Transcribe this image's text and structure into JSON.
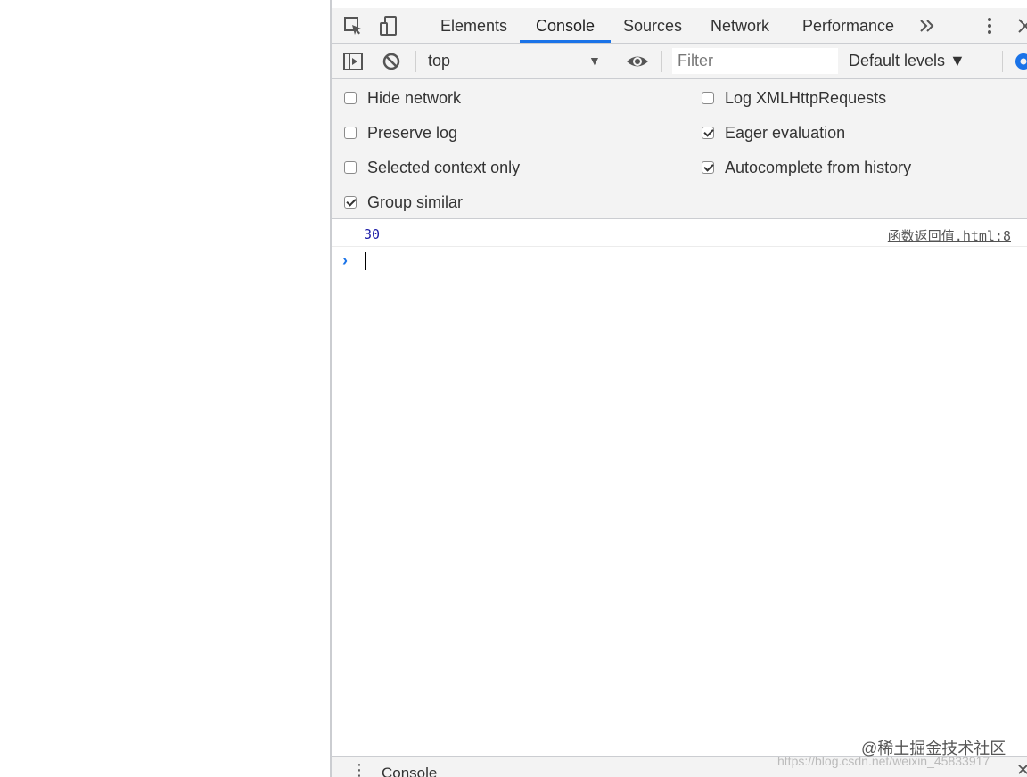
{
  "tabs": [
    "Elements",
    "Console",
    "Sources",
    "Network",
    "Performance"
  ],
  "active_tab": "Console",
  "toolbar": {
    "context": "top",
    "filter_placeholder": "Filter",
    "levels": "Default levels ▼"
  },
  "settings": {
    "hide_network": {
      "label": "Hide network",
      "checked": false
    },
    "preserve_log": {
      "label": "Preserve log",
      "checked": false
    },
    "selected_context_only": {
      "label": "Selected context only",
      "checked": false
    },
    "group_similar": {
      "label": "Group similar",
      "checked": true
    },
    "log_xhr": {
      "label": "Log XMLHttpRequests",
      "checked": false
    },
    "eager_evaluation": {
      "label": "Eager evaluation",
      "checked": true
    },
    "autocomplete_history": {
      "label": "Autocomplete from history",
      "checked": true
    }
  },
  "console": {
    "message_value": "30",
    "message_source": "函数返回值.html:8"
  },
  "drawer": {
    "tab": "Console"
  },
  "watermark": {
    "main": "@稀土掘金技术社区",
    "sub": "https://blog.csdn.net/weixin_45833917"
  },
  "colors": {
    "accent": "#1a73e8",
    "number": "#1a1aa6"
  }
}
